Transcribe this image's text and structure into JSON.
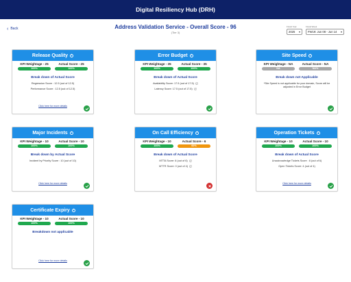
{
  "app": {
    "title": "Digital Resiliency Hub (DRH)"
  },
  "header": {
    "back_label": "Back",
    "service_title": "Address Validation Service - Overall Score - 96",
    "tier": "(Tier 3)",
    "fiscal_year": {
      "label": "Fiscal Year",
      "value": "2025"
    },
    "fiscal_week": {
      "label": "Fiscal Week",
      "value": "FW19: Jun 08 - Jun 14"
    }
  },
  "colors": {
    "topbar": "#0d2167",
    "card_header": "#1f8fe6",
    "pill_green": "#1fa84e",
    "pill_orange": "#f0960e",
    "pill_grey": "#a8a8a8",
    "status_ok": "#27a047",
    "status_bad": "#d32f2f"
  },
  "cards": [
    {
      "title": "Release Quality",
      "weight_label": "KPI Weightage - 25",
      "weight_pill": "100%",
      "score_label": "Actual Score - 25",
      "score_pill": "100%",
      "breakdown_title": "Break down of Actual Score",
      "lines": [
        "Regression Score : 12.5 (out of 12.5)",
        "Performance Score : 12.5 (out of 12.5)"
      ],
      "link": "Click here for more details",
      "status": "check-icon"
    },
    {
      "title": "Error Budget",
      "weight_label": "KPI Weightage - 35",
      "weight_pill": "100%",
      "score_label": "Actual Score - 35",
      "score_pill": "100%",
      "breakdown_title": "Break down of Actual Score",
      "lines": [
        "Availability Score: 17.5 (out of 17.5)",
        "Latency Score: 17.5 (out of 17.5)"
      ],
      "status": "check-icon"
    },
    {
      "title": "Site Speed",
      "weight_label": "KPI Weightage - NA",
      "weight_pill": "NA",
      "score_label": "Actual Score - NA",
      "score_pill": "NA%",
      "breakdown_title": "Break down not Applicable",
      "note": "*Site Speed is not applicable for your domain, Score will be adjusted in Error Budget",
      "status": "check-icon"
    },
    {
      "title": "Major Incidents",
      "weight_label": "KPI Weightage - 10",
      "weight_pill": "100%",
      "score_label": "Actual Score - 10",
      "score_pill": "100%",
      "breakdown_title": "Break down by Actual Score",
      "lines": [
        "Incident by Priority Score : 10 (out of 10)"
      ],
      "link": "Click here for more details",
      "status": "check-icon"
    },
    {
      "title": "On Call Efficiency",
      "weight_label": "KPI Weightage - 10",
      "weight_pill": "100%",
      "score_label": "Actual Score - 6",
      "score_pill": "60%",
      "breakdown_title": "Break down of Actual Score",
      "lines": [
        "MTTA Score: 6 (out of 6)",
        "MTTR Score: 0 (out of 4)"
      ],
      "status": "cross-icon"
    },
    {
      "title": "Operation Tickets",
      "weight_label": "KPI Weightage - 10",
      "weight_pill": "100%",
      "score_label": "Actual Score - 10",
      "score_pill": "100%",
      "breakdown_title": "Break down of Actual Score",
      "lines": [
        "Unacknowledge Tickets Score : 6 (out of 6)",
        "Open Tickets Score: 4 (out of 4)"
      ],
      "link": "Click here for more details",
      "status": "check-icon"
    },
    {
      "title": "Certificate Expiry",
      "weight_label": "KPI Weightage - 10",
      "weight_pill": "100%",
      "score_label": "Actual Score - 10",
      "score_pill": "100%",
      "breakdown_title": "Breakdown not applicable",
      "link": "Click here for more details",
      "status": "check-icon"
    }
  ]
}
